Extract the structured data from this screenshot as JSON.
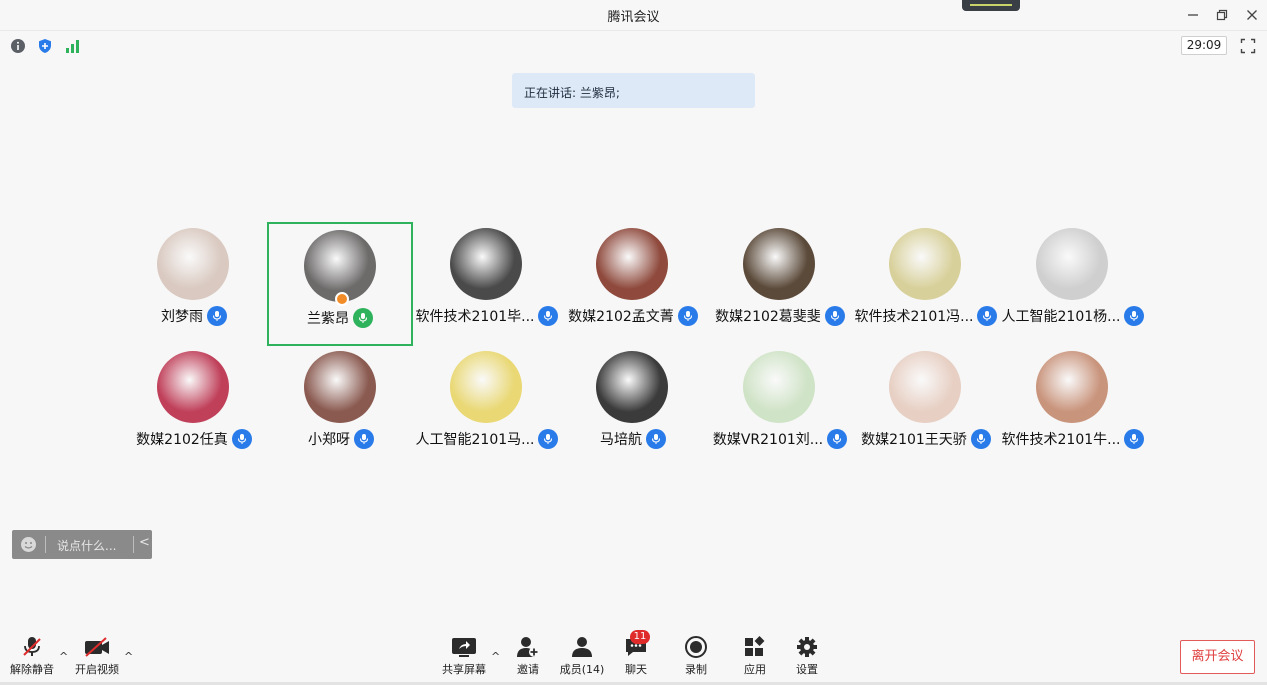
{
  "window": {
    "title": "腾讯会议"
  },
  "status": {
    "timer": "29:09"
  },
  "speaking": {
    "text": "正在讲话: 兰紫昂;"
  },
  "participants": [
    {
      "name": "刘梦雨",
      "color": "#d9c9c0"
    },
    {
      "name": "兰紫昂",
      "color": "#6d6a6a",
      "active": true
    },
    {
      "name": "软件技术2101毕...",
      "color": "#4a4a4a"
    },
    {
      "name": "数媒2102孟文菁",
      "color": "#8f4a3d"
    },
    {
      "name": "数媒2102葛斐斐",
      "color": "#5b4a3a"
    },
    {
      "name": "软件技术2101冯...",
      "color": "#d8d09a"
    },
    {
      "name": "人工智能2101杨...",
      "color": "#cfcfcf"
    },
    {
      "name": "数媒2102任真",
      "color": "#c0405a"
    },
    {
      "name": "小郑呀",
      "color": "#8a5a50"
    },
    {
      "name": "人工智能2101马...",
      "color": "#e9d874"
    },
    {
      "name": "马培航",
      "color": "#3b3b3b"
    },
    {
      "name": "数媒VR2101刘...",
      "color": "#cfe3c6"
    },
    {
      "name": "数媒2101王天骄",
      "color": "#e7cfc3"
    },
    {
      "name": "软件技术2101牛...",
      "color": "#c9947c"
    }
  ],
  "chat": {
    "placeholder": "说点什么..."
  },
  "toolbar": {
    "unmute": "解除静音",
    "video": "开启视频",
    "share": "共享屏幕",
    "invite": "邀请",
    "members": "成员(14)",
    "chat": "聊天",
    "chat_badge": "11",
    "record": "录制",
    "apps": "应用",
    "settings": "设置",
    "leave": "离开会议"
  }
}
